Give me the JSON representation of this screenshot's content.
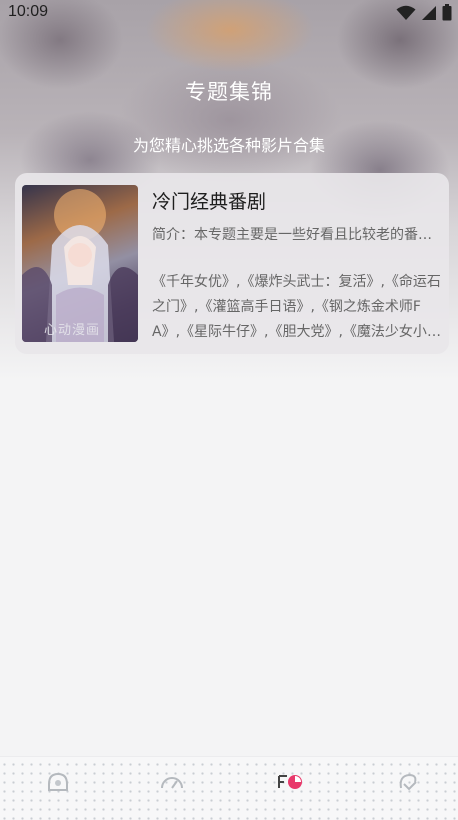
{
  "status_bar": {
    "time": "10:09",
    "icons": [
      "wifi-icon",
      "cellular-signal-icon",
      "battery-icon"
    ]
  },
  "header": {
    "title": "专题集锦",
    "subtitle": "为您精心挑选各种影片合集"
  },
  "collections": [
    {
      "title": "冷门经典番剧",
      "intro": "简介：本专题主要是一些好看且比较老的番剧合集",
      "works": "《千年女优》,《爆炸头武士：复活》,《命运石之门》,《灌篮高手日语》,《钢之炼金术师FA》,《星际牛仔》,《胆大党》,《魔法少女小圆》",
      "poster_caption": "心动漫画"
    }
  ],
  "tab_bar": {
    "items": [
      {
        "icon": "home-icon"
      },
      {
        "icon": "gauge-icon"
      },
      {
        "icon": "collection-icon"
      },
      {
        "icon": "profile-icon"
      }
    ],
    "active_color": "#e8396b"
  }
}
